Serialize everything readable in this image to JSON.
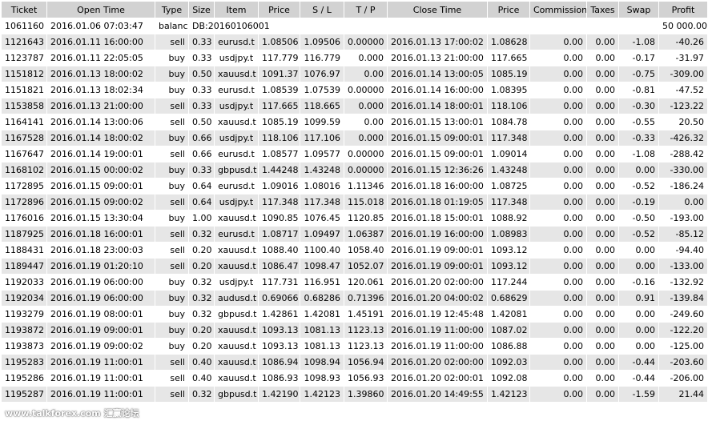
{
  "columns": [
    "Ticket",
    "Open Time",
    "Type",
    "Size",
    "Item",
    "Price",
    "S / L",
    "T / P",
    "Close Time",
    "Price",
    "Commission",
    "Taxes",
    "Swap",
    "Profit"
  ],
  "balance_row": {
    "ticket": "1061160",
    "open_time": "2016.01.06 07:03:47",
    "type": "balance",
    "comment": "DB:20160106001",
    "profit": "50 000.00"
  },
  "rows": [
    [
      "1121643",
      "2016.01.11 16:00:00",
      "sell",
      "0.33",
      "eurusd.t",
      "1.08506",
      "1.09506",
      "0.00000",
      "2016.01.13 17:00:02",
      "1.08628",
      "0.00",
      "0.00",
      "-1.08",
      "-40.26"
    ],
    [
      "1123787",
      "2016.01.11 22:05:05",
      "buy",
      "0.33",
      "usdjpy.t",
      "117.779",
      "116.779",
      "0.000",
      "2016.01.13 21:00:00",
      "117.665",
      "0.00",
      "0.00",
      "-0.17",
      "-31.97"
    ],
    [
      "1151812",
      "2016.01.13 18:00:02",
      "buy",
      "0.50",
      "xauusd.t",
      "1091.37",
      "1076.97",
      "0.00",
      "2016.01.14 13:00:05",
      "1085.19",
      "0.00",
      "0.00",
      "-0.75",
      "-309.00"
    ],
    [
      "1151821",
      "2016.01.13 18:02:34",
      "buy",
      "0.33",
      "eurusd.t",
      "1.08539",
      "1.07539",
      "0.00000",
      "2016.01.14 16:00:00",
      "1.08395",
      "0.00",
      "0.00",
      "-0.81",
      "-47.52"
    ],
    [
      "1153858",
      "2016.01.13 21:00:00",
      "sell",
      "0.33",
      "usdjpy.t",
      "117.665",
      "118.665",
      "0.000",
      "2016.01.14 18:00:01",
      "118.106",
      "0.00",
      "0.00",
      "-0.30",
      "-123.22"
    ],
    [
      "1164141",
      "2016.01.14 13:00:06",
      "sell",
      "0.50",
      "xauusd.t",
      "1085.19",
      "1099.59",
      "0.00",
      "2016.01.15 13:00:01",
      "1084.78",
      "0.00",
      "0.00",
      "-0.55",
      "20.50"
    ],
    [
      "1167528",
      "2016.01.14 18:00:02",
      "buy",
      "0.66",
      "usdjpy.t",
      "118.106",
      "117.106",
      "0.000",
      "2016.01.15 09:00:01",
      "117.348",
      "0.00",
      "0.00",
      "-0.33",
      "-426.32"
    ],
    [
      "1167647",
      "2016.01.14 19:00:01",
      "sell",
      "0.66",
      "eurusd.t",
      "1.08577",
      "1.09577",
      "0.00000",
      "2016.01.15 09:00:01",
      "1.09014",
      "0.00",
      "0.00",
      "-1.08",
      "-288.42"
    ],
    [
      "1168102",
      "2016.01.15 00:00:02",
      "buy",
      "0.33",
      "gbpusd.t",
      "1.44248",
      "1.43248",
      "0.00000",
      "2016.01.15 12:36:26",
      "1.43248",
      "0.00",
      "0.00",
      "0.00",
      "-330.00"
    ],
    [
      "1172895",
      "2016.01.15 09:00:01",
      "buy",
      "0.64",
      "eurusd.t",
      "1.09016",
      "1.08016",
      "1.11346",
      "2016.01.18 16:00:00",
      "1.08725",
      "0.00",
      "0.00",
      "-0.52",
      "-186.24"
    ],
    [
      "1172896",
      "2016.01.15 09:00:02",
      "sell",
      "0.64",
      "usdjpy.t",
      "117.348",
      "117.348",
      "115.018",
      "2016.01.18 01:19:05",
      "117.348",
      "0.00",
      "0.00",
      "-0.19",
      "0.00"
    ],
    [
      "1176016",
      "2016.01.15 13:30:04",
      "buy",
      "1.00",
      "xauusd.t",
      "1090.85",
      "1076.45",
      "1120.85",
      "2016.01.18 15:00:01",
      "1088.92",
      "0.00",
      "0.00",
      "-0.50",
      "-193.00"
    ],
    [
      "1187925",
      "2016.01.18 16:00:01",
      "sell",
      "0.32",
      "eurusd.t",
      "1.08717",
      "1.09497",
      "1.06387",
      "2016.01.19 16:00:00",
      "1.08983",
      "0.00",
      "0.00",
      "-0.52",
      "-85.12"
    ],
    [
      "1188431",
      "2016.01.18 23:00:03",
      "sell",
      "0.20",
      "xauusd.t",
      "1088.40",
      "1100.40",
      "1058.40",
      "2016.01.19 09:00:01",
      "1093.12",
      "0.00",
      "0.00",
      "0.00",
      "-94.40"
    ],
    [
      "1189447",
      "2016.01.19 01:20:10",
      "sell",
      "0.20",
      "xauusd.t",
      "1086.47",
      "1098.47",
      "1052.07",
      "2016.01.19 09:00:01",
      "1093.12",
      "0.00",
      "0.00",
      "0.00",
      "-133.00"
    ],
    [
      "1192033",
      "2016.01.19 06:00:00",
      "buy",
      "0.32",
      "usdjpy.t",
      "117.731",
      "116.951",
      "120.061",
      "2016.01.20 02:00:00",
      "117.244",
      "0.00",
      "0.00",
      "-0.16",
      "-132.92"
    ],
    [
      "1192034",
      "2016.01.19 06:00:00",
      "buy",
      "0.32",
      "audusd.t",
      "0.69066",
      "0.68286",
      "0.71396",
      "2016.01.20 04:00:02",
      "0.68629",
      "0.00",
      "0.00",
      "0.91",
      "-139.84"
    ],
    [
      "1193279",
      "2016.01.19 08:00:01",
      "buy",
      "0.32",
      "gbpusd.t",
      "1.42861",
      "1.42081",
      "1.45191",
      "2016.01.19 12:45:48",
      "1.42081",
      "0.00",
      "0.00",
      "0.00",
      "-249.60"
    ],
    [
      "1193872",
      "2016.01.19 09:00:01",
      "buy",
      "0.20",
      "xauusd.t",
      "1093.13",
      "1081.13",
      "1123.13",
      "2016.01.19 11:00:00",
      "1087.02",
      "0.00",
      "0.00",
      "0.00",
      "-122.20"
    ],
    [
      "1193873",
      "2016.01.19 09:00:02",
      "buy",
      "0.20",
      "xauusd.t",
      "1093.13",
      "1081.13",
      "1123.13",
      "2016.01.19 11:00:00",
      "1086.88",
      "0.00",
      "0.00",
      "0.00",
      "-125.00"
    ],
    [
      "1195283",
      "2016.01.19 11:00:01",
      "sell",
      "0.40",
      "xauusd.t",
      "1086.94",
      "1098.94",
      "1056.94",
      "2016.01.20 02:00:00",
      "1092.03",
      "0.00",
      "0.00",
      "-0.44",
      "-203.60"
    ],
    [
      "1195286",
      "2016.01.19 11:00:01",
      "sell",
      "0.40",
      "xauusd.t",
      "1086.93",
      "1098.93",
      "1056.93",
      "2016.01.20 02:00:01",
      "1092.08",
      "0.00",
      "0.00",
      "-0.44",
      "-206.00"
    ],
    [
      "1195287",
      "2016.01.19 11:00:01",
      "sell",
      "0.32",
      "gbpusd.t",
      "1.42190",
      "1.42123",
      "1.39860",
      "2016.01.20 14:49:55",
      "1.42123",
      "0.00",
      "0.00",
      "-1.59",
      "21.44"
    ]
  ],
  "watermark": "www.talkforex.com 汇赢论坛",
  "colors": {
    "header_bg": "#d2d2d2",
    "row_odd_bg": "#e6e6e6",
    "row_even_bg": "#ffffff"
  }
}
